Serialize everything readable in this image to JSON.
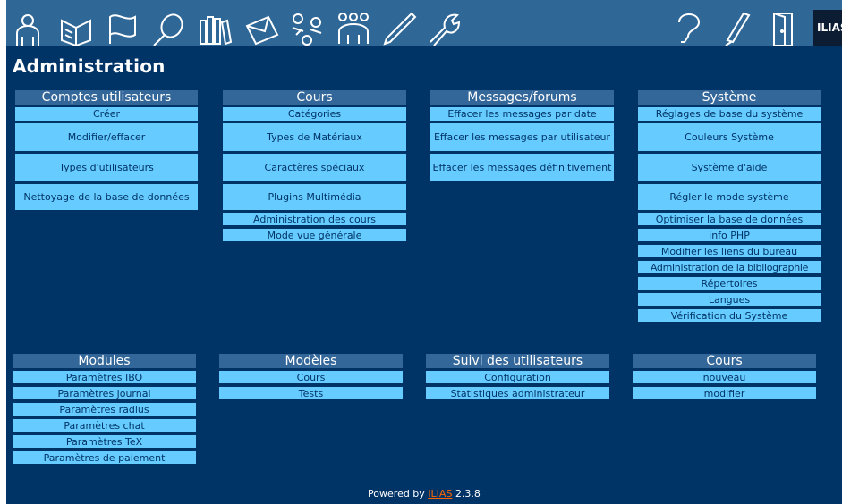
{
  "toolbar": {
    "icons": [
      "user-icon",
      "book-icon",
      "flag-icon",
      "search-icon",
      "library-icon",
      "mail-icon",
      "groups-icon",
      "users-icon",
      "pen-icon",
      "wrench-icon"
    ],
    "right_icons": [
      "help-icon",
      "feedback-icon",
      "logout-icon"
    ],
    "logo": "ILIAS"
  },
  "page": {
    "title": "Administration"
  },
  "panels": {
    "comptes": {
      "title": "Comptes utilisateurs",
      "items": [
        "Créer",
        "Modifier/effacer",
        "Types d'utilisateurs",
        "Nettoyage de la base de données"
      ]
    },
    "cours": {
      "title": "Cours",
      "items": [
        "Catégories",
        "Types de Matériaux",
        "Caractères spéciaux",
        "Plugins Multimédia",
        "Administration des cours",
        "Mode vue générale"
      ]
    },
    "messages": {
      "title": "Messages/forums",
      "items": [
        "Effacer les messages par date",
        "Effacer les messages par utilisateur",
        "Effacer les messages définitivement"
      ]
    },
    "systeme": {
      "title": "Système",
      "items": [
        "Réglages de base du système",
        "Couleurs Système",
        "Système d'aide",
        "Régler le mode système",
        "Optimiser la base de données",
        "info PHP",
        "Modifier les liens du bureau",
        "Administration de la bibliographie",
        "Répertoires",
        "Langues",
        "Vérification du Système"
      ]
    },
    "modules": {
      "title": "Modules",
      "items": [
        "Paramètres IBO",
        "Paramètres journal",
        "Paramètres radius",
        "Paramètres chat",
        "Paramètres TeX",
        "Paramètres de paiement"
      ]
    },
    "modeles": {
      "title": "Modèles",
      "items": [
        "Cours",
        "Tests"
      ]
    },
    "suivi": {
      "title": "Suivi des utilisateurs",
      "items": [
        "Configuration",
        "Statistiques administrateur"
      ]
    },
    "cours2": {
      "title": "Cours",
      "items": [
        "nouveau",
        "modifier"
      ]
    }
  },
  "footer": {
    "prefix": "Powered by ",
    "link": "ILIAS",
    "version": " 2.3.8"
  },
  "colors": {
    "background": "#003366",
    "toolbar": "#2f6797",
    "header": "#336699",
    "item": "#66ccff",
    "link": "#ff6600"
  }
}
